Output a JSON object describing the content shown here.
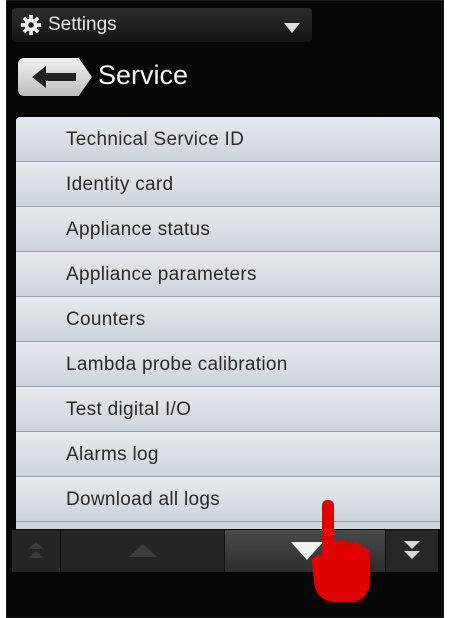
{
  "topbar": {
    "title": "Settings",
    "gear_icon": "gear-icon",
    "dropdown_icon": "dropdown-arrow-icon"
  },
  "header": {
    "back_icon": "back-arrow-icon",
    "title": "Service"
  },
  "menu": {
    "items": [
      {
        "label": "Technical Service ID"
      },
      {
        "label": "Identity card"
      },
      {
        "label": "Appliance status"
      },
      {
        "label": "Appliance parameters"
      },
      {
        "label": "Counters"
      },
      {
        "label": "Lambda probe calibration"
      },
      {
        "label": "Test digital I/O"
      },
      {
        "label": "Alarms log"
      },
      {
        "label": "Download all logs"
      }
    ]
  },
  "bottombar": {
    "icons": [
      "scroll-top-icon",
      "scroll-up-icon",
      "scroll-down-icon",
      "scroll-bottom-icon"
    ]
  },
  "colors": {
    "screen_bg": "#070707",
    "list_item": "#dde2e7",
    "pointer_hand": "#e00000"
  }
}
